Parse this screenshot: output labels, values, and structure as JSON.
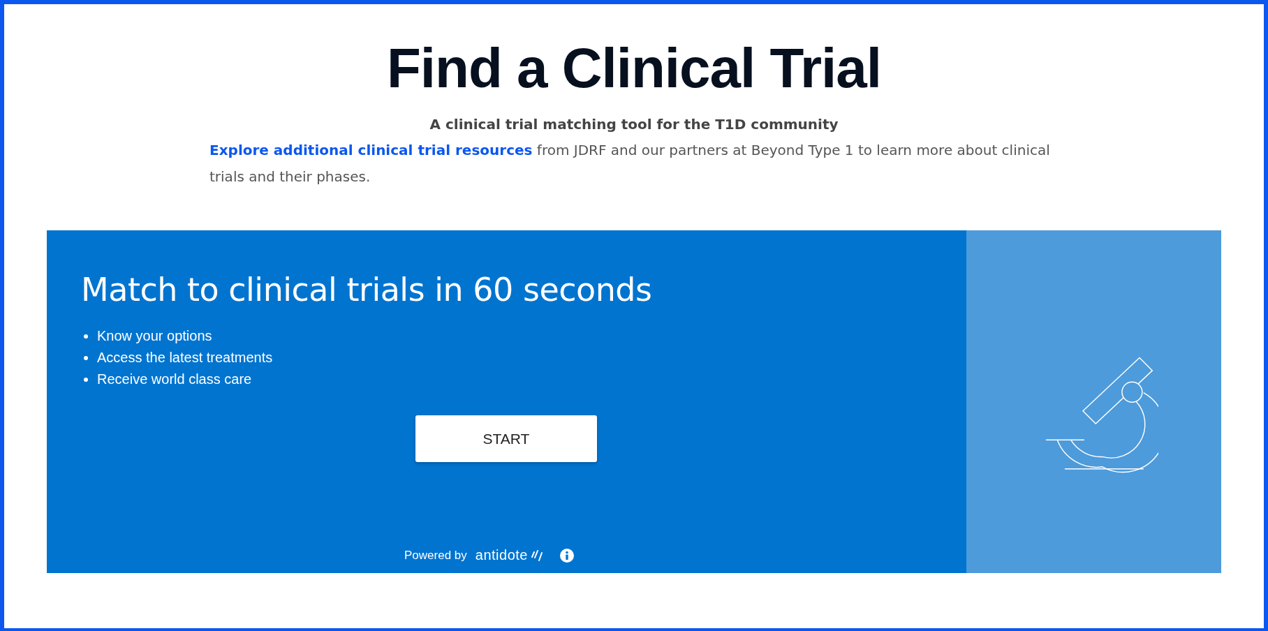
{
  "title": "Find a Clinical Trial",
  "subtitle": "A clinical trial matching tool for the T1D community",
  "intro": {
    "link": "Explore additional clinical trial resources",
    "text": "from JDRF and our partners at Beyond Type 1 to learn more about clinical trials and their phases."
  },
  "banner": {
    "heading": "Match to clinical trials in 60 seconds",
    "bullets": [
      "Know your options",
      "Access the latest treatments",
      "Receive world class care"
    ],
    "button": "START",
    "powered_by": "Powered by",
    "brand": "antidote"
  }
}
